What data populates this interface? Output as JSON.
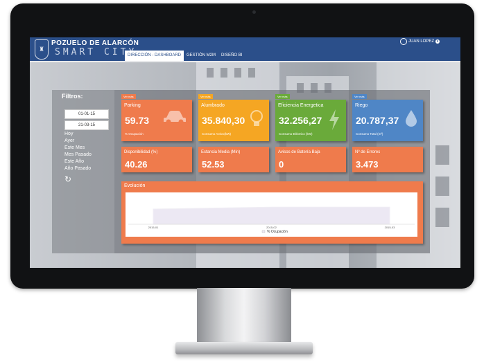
{
  "header": {
    "brand_line1": "POZUELO DE ALARCÓN",
    "brand_line2": "SMART CITY",
    "tabs": [
      {
        "label": "DIRECCIÓN - DASHBOARD",
        "active": true
      },
      {
        "label": "GESTIÓN M2M",
        "active": false
      },
      {
        "label": "DISEÑO BI",
        "active": false
      }
    ],
    "user_name": "JUAN LOPEZ"
  },
  "filters": {
    "title": "Filtros:",
    "date_from": "01-01-15",
    "date_to": "21-03-15",
    "options": [
      "Hoy",
      "Ayer",
      "Este Mes",
      "Mes Pasado",
      "Este Año",
      "Año Pasado"
    ],
    "refresh_icon": "refresh-icon"
  },
  "cards": [
    {
      "vermas": "Ver más",
      "title": "Parking",
      "value": "59.73",
      "sub": "% Ocupación",
      "color": "#ef7b4c",
      "icon": "car-icon"
    },
    {
      "vermas": "Ver más",
      "title": "Alumbrado",
      "value": "35.840,30",
      "sub": "Consumo Activo(kW)",
      "color": "#f5a623",
      "icon": "lightbulb-icon"
    },
    {
      "vermas": "Ver más",
      "title": "Eficiencia Energetica",
      "value": "32.256,27",
      "sub": "Consumo Eléctrico (kW)",
      "color": "#6aaa3a",
      "icon": "lightning-icon"
    },
    {
      "vermas": "Ver más",
      "title": "Riego",
      "value": "20.787,37",
      "sub": "Consumo Total (m³)",
      "color": "#4f86c6",
      "icon": "water-drop-icon"
    }
  ],
  "kpis": [
    {
      "title": "Disponibilidad (%)",
      "value": "40.26"
    },
    {
      "title": "Estancia Media (Min)",
      "value": "52.53"
    },
    {
      "title": "Avisos de Batería Baja",
      "value": "0"
    },
    {
      "title": "Nº de Errores",
      "value": "3.473"
    }
  ],
  "evolution": {
    "title": "Evolución"
  },
  "chart_data": {
    "type": "area",
    "title": "Evolución",
    "x": [
      "2015-01",
      "2015-02",
      "2015-03"
    ],
    "series": [
      {
        "name": "% Ocupación",
        "values": [
          55,
          62,
          62
        ]
      }
    ],
    "ylim": [
      0,
      100
    ],
    "legend": "bottom-center",
    "grid": false
  }
}
